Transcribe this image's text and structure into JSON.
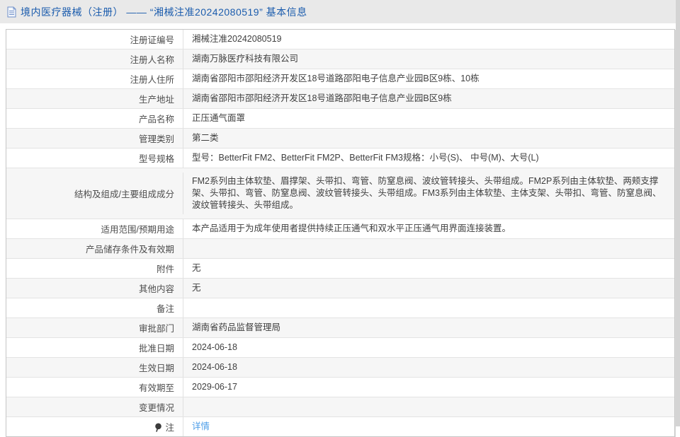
{
  "colors": {
    "header_bg": "#e9e9e9",
    "title_blue": "#1b5cad",
    "link_blue": "#4d9ee8",
    "stripe_gray": "#f6f6f6",
    "border_gray": "#c6c6c6"
  },
  "header": {
    "icon": "document-icon",
    "title": "境内医疗器械（注册） —— “湘械注准20242080519” 基本信息"
  },
  "table": {
    "rows": [
      {
        "label": "注册证编号",
        "value": "湘械注准20242080519"
      },
      {
        "label": "注册人名称",
        "value": "湖南万脉医疗科技有限公司"
      },
      {
        "label": "注册人住所",
        "value": "湖南省邵阳市邵阳经济开发区18号道路邵阳电子信息产业园B区9栋、10栋"
      },
      {
        "label": "生产地址",
        "value": "湖南省邵阳市邵阳经济开发区18号道路邵阳电子信息产业园B区9栋"
      },
      {
        "label": "产品名称",
        "value": "正压通气面罩"
      },
      {
        "label": "管理类别",
        "value": "第二类"
      },
      {
        "label": "型号规格",
        "value": "型号：BetterFit FM2、BetterFit FM2P、BetterFit FM3规格：小号(S)、 中号(M)、大号(L)"
      },
      {
        "label": "结构及组成/主要组成成分",
        "value": "FM2系列由主体软垫、眉撑架、头带扣、弯管、防窒息阀、波纹管转接头、头带组成。FM2P系列由主体软垫、两颊支撑架、头带扣、弯管、防窒息阀、波纹管转接头、头带组成。FM3系列由主体软垫、主体支架、头带扣、弯管、防窒息阀、波纹管转接头、头带组成。"
      },
      {
        "label": "适用范围/预期用途",
        "value": "本产品适用于为成年使用者提供持续正压通气和双水平正压通气用界面连接装置。"
      },
      {
        "label": "产品储存条件及有效期",
        "value": ""
      },
      {
        "label": "附件",
        "value": "无"
      },
      {
        "label": "其他内容",
        "value": "无"
      },
      {
        "label": "备注",
        "value": ""
      },
      {
        "label": "审批部门",
        "value": "湖南省药品监督管理局"
      },
      {
        "label": "批准日期",
        "value": "2024-06-18"
      },
      {
        "label": "生效日期",
        "value": "2024-06-18"
      },
      {
        "label": "有效期至",
        "value": "2029-06-17"
      },
      {
        "label": "变更情况",
        "value": ""
      },
      {
        "label": "注",
        "value": "详情",
        "label_icon": "pin-icon",
        "value_is_link": true
      }
    ]
  }
}
